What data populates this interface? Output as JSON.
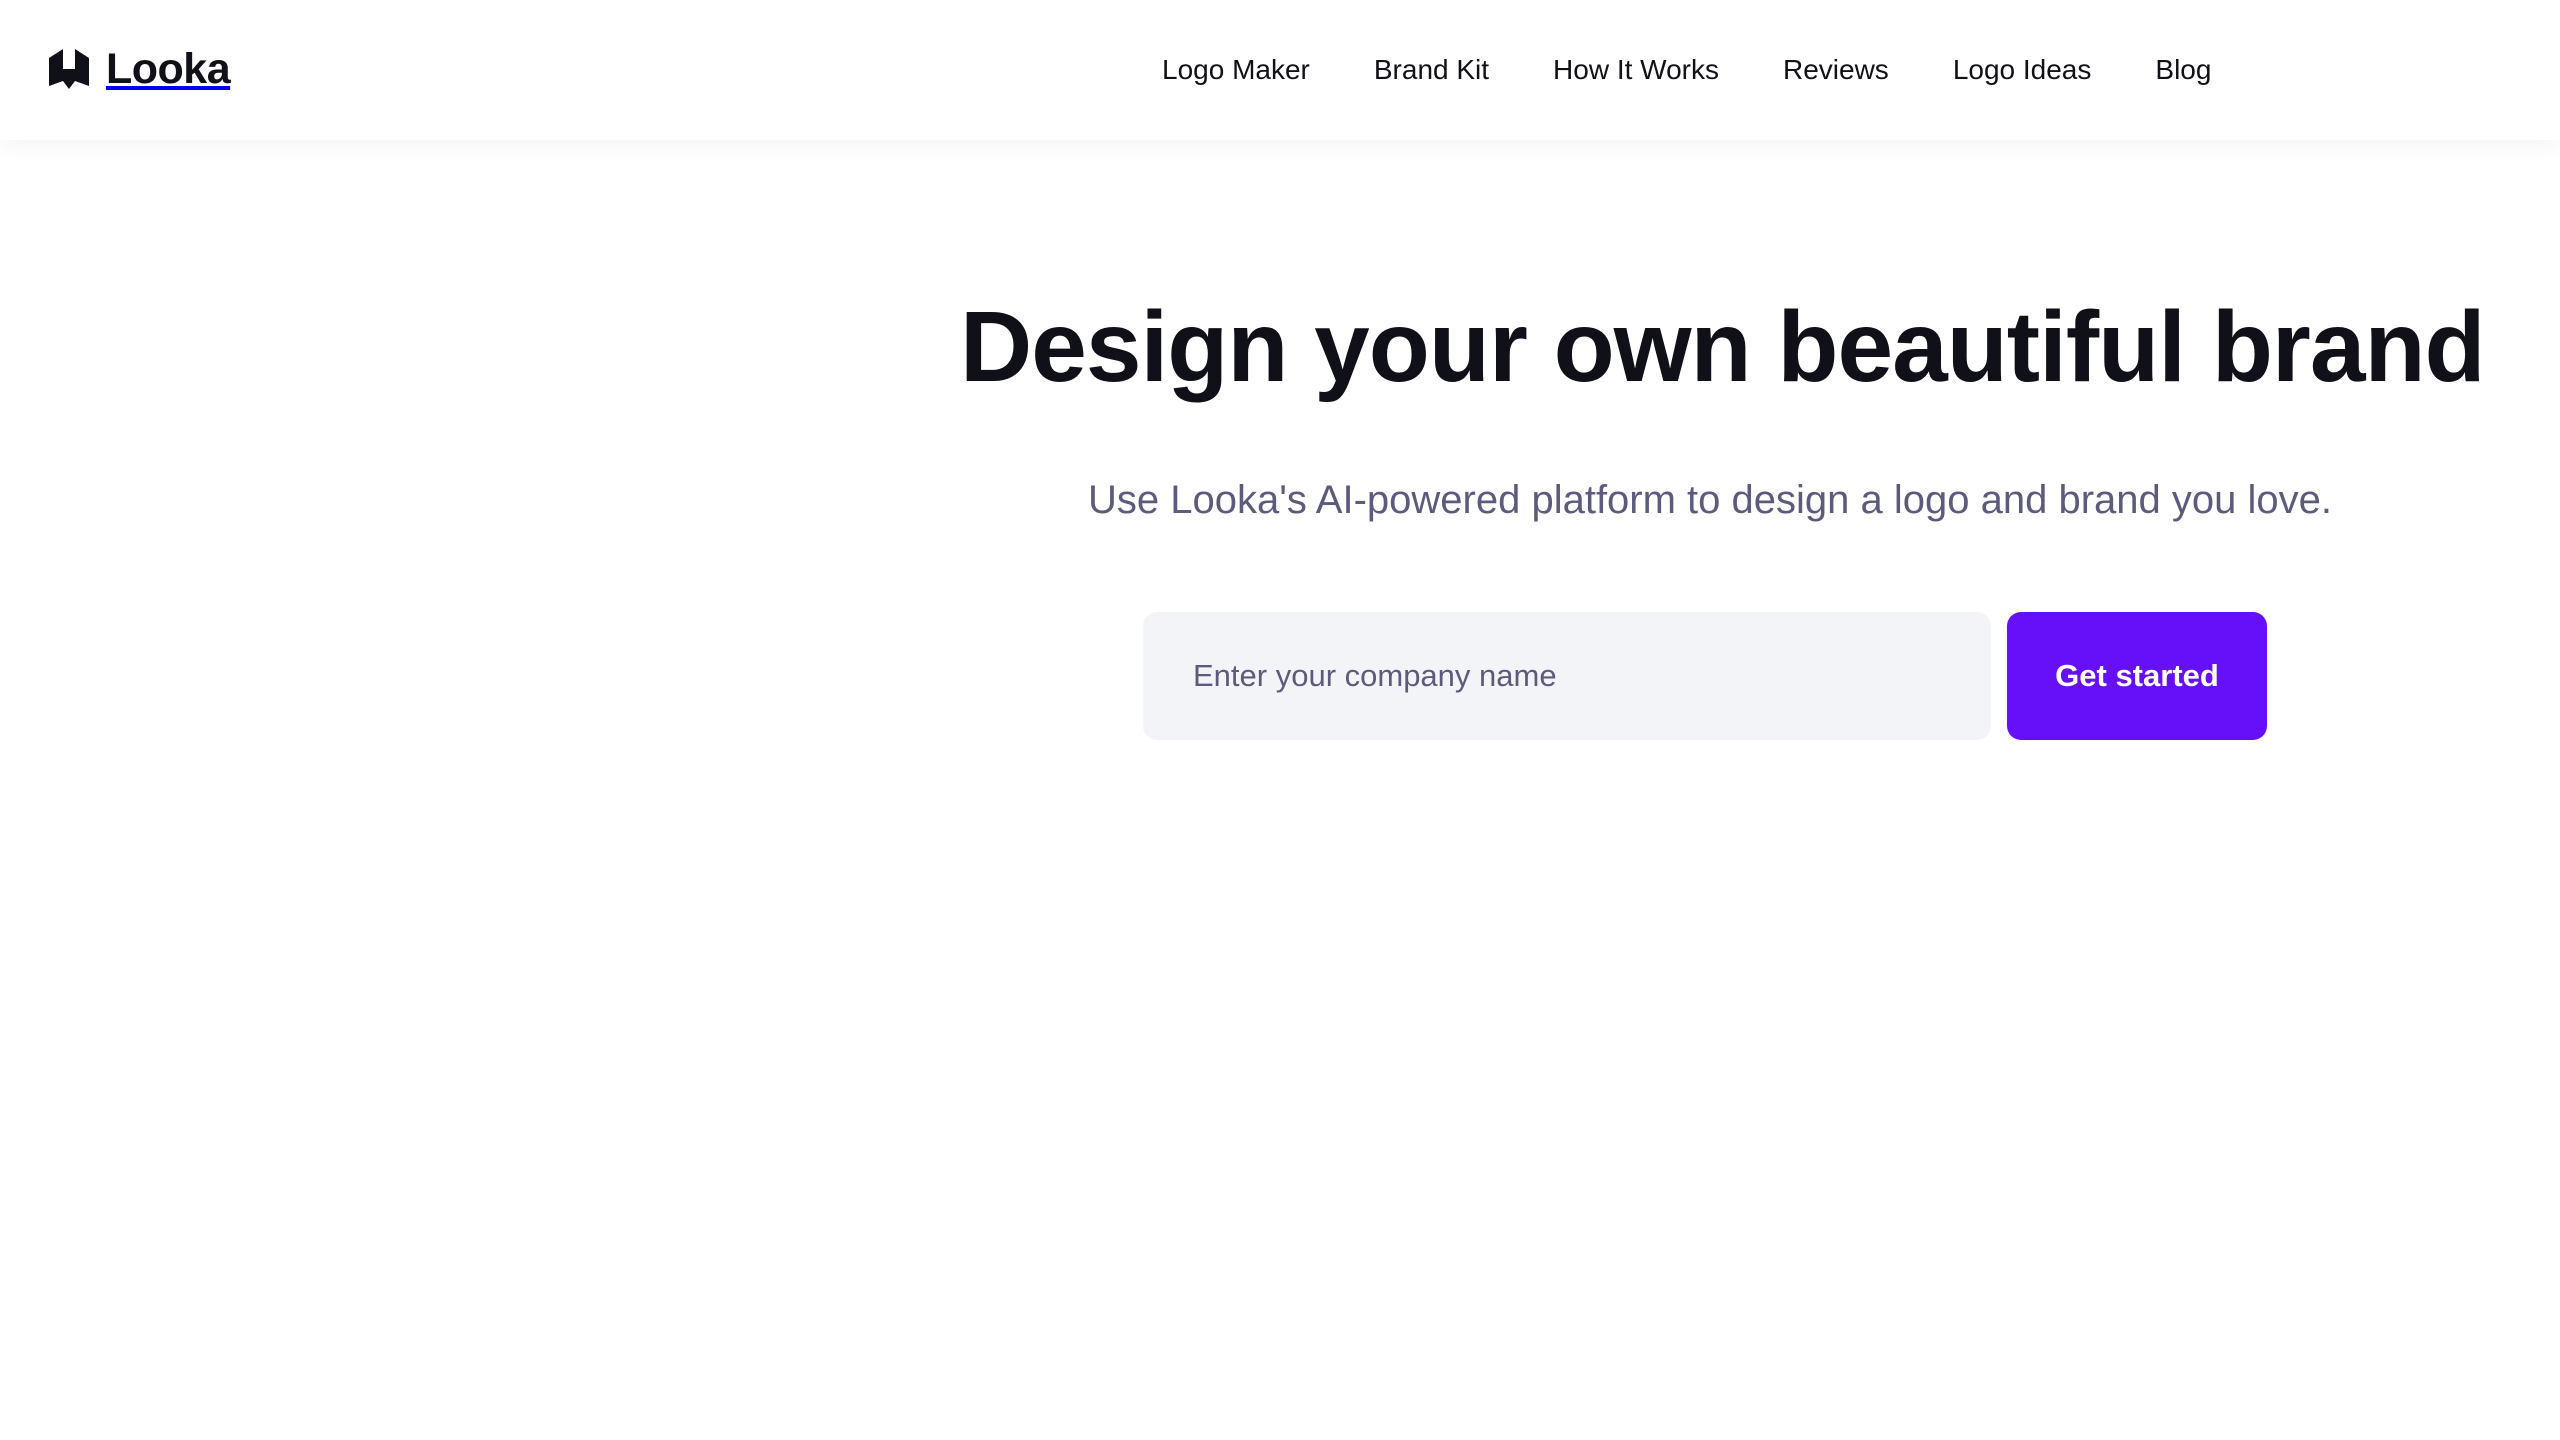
{
  "header": {
    "brand_name": "Looka",
    "nav": [
      {
        "label": "Logo Maker"
      },
      {
        "label": "Brand Kit"
      },
      {
        "label": "How It Works"
      },
      {
        "label": "Reviews"
      },
      {
        "label": "Logo Ideas"
      },
      {
        "label": "Blog"
      }
    ]
  },
  "hero": {
    "title": "Design your own beautiful brand",
    "subtitle": "Use Looka's AI-powered platform to design a logo and brand you love.",
    "input": {
      "value": "",
      "placeholder": "Enter your company name"
    },
    "cta_label": "Get started"
  },
  "icons": {
    "logo": "looka-hexagon-logo-icon"
  },
  "colors": {
    "accent": "#6610f9",
    "text_primary": "#101018",
    "text_secondary": "#5d5b7d",
    "input_background": "#f3f4f8",
    "background": "#ffffff"
  }
}
